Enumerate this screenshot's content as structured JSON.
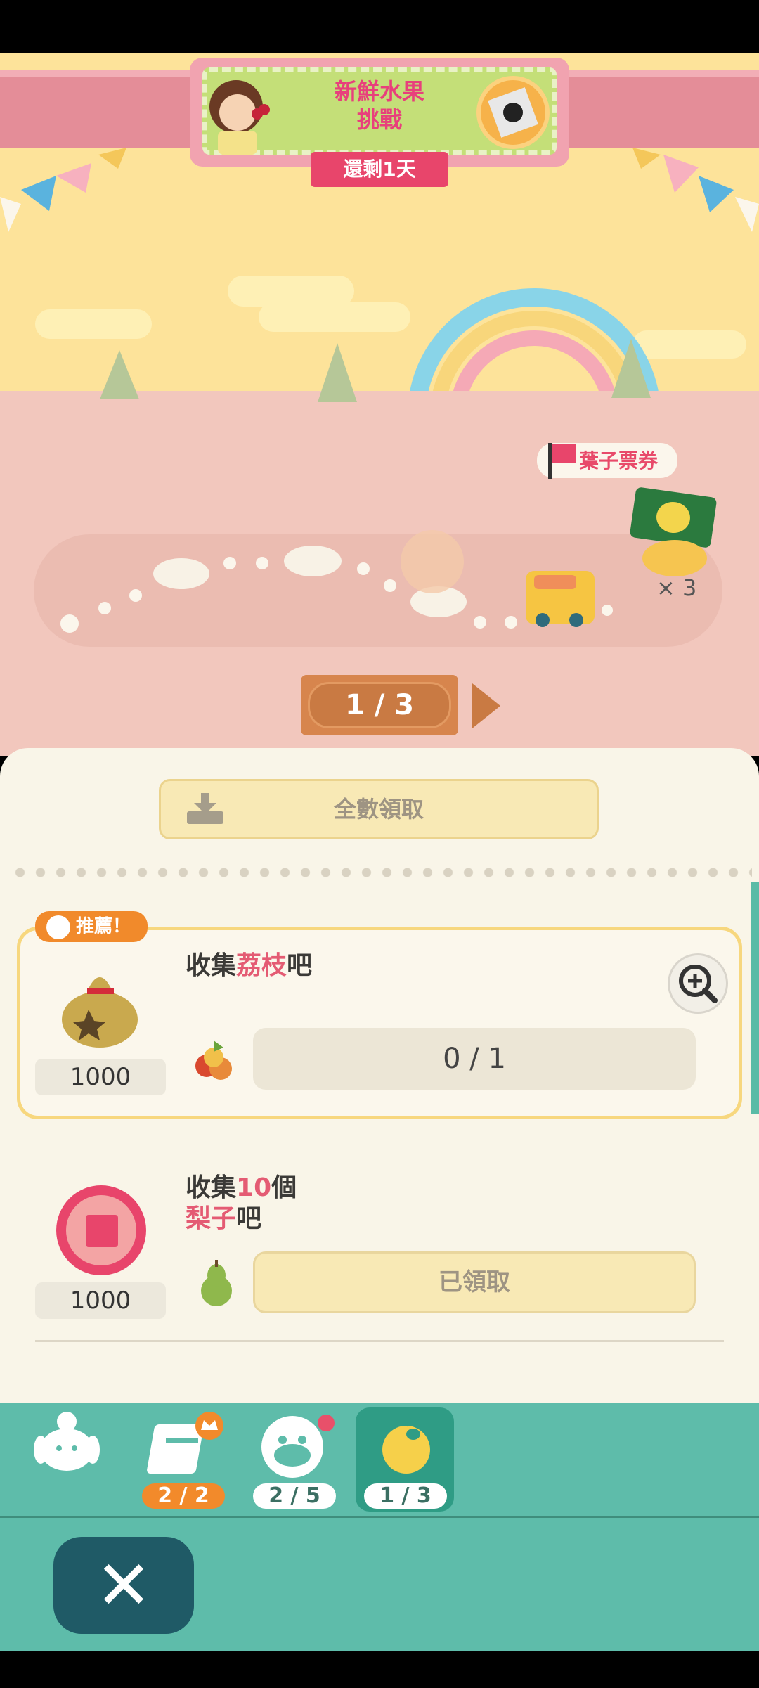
{
  "banner": {
    "title_line1": "新鮮水果",
    "title_line2": "挑戰",
    "days_left": "還剩1天"
  },
  "map": {
    "flag_label": "葉子票券",
    "reward_multiplier": "× 3",
    "page_indicator": "1 / 3"
  },
  "panel": {
    "collect_all_label": "全數領取",
    "recommended_label": "推薦！",
    "tasks": [
      {
        "title_prefix": "收集",
        "title_highlight": "荔枝",
        "title_suffix": "吧",
        "reward": "1000",
        "progress": "0 / 1"
      },
      {
        "title_line1_prefix": "收集",
        "title_line1_highlight": "10",
        "title_line1_suffix": "個",
        "title_line2_highlight": "梨子",
        "title_line2_suffix": "吧",
        "reward": "1000",
        "status": "已領取"
      }
    ]
  },
  "nav": {
    "tabs": [
      {
        "icon": "isabelle-icon",
        "count": ""
      },
      {
        "icon": "calendar-crown-icon",
        "count": "2 / 2"
      },
      {
        "icon": "villager-face-icon",
        "count": "2 / 5"
      },
      {
        "icon": "fruit-icon",
        "count": "1 / 3"
      }
    ]
  },
  "colors": {
    "accent_pink": "#e8456b",
    "nav_teal": "#5ebcaa",
    "panel_bg": "#f9f5e8"
  }
}
